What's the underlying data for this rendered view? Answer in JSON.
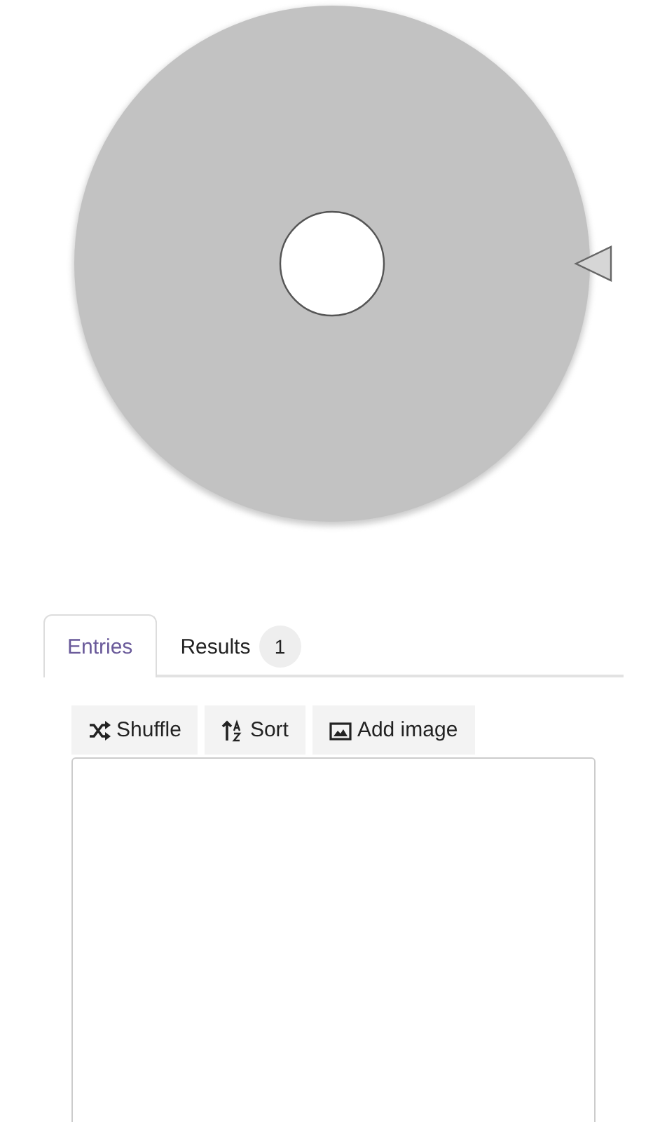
{
  "tabs": [
    {
      "label": "Entries",
      "selected": true
    },
    {
      "label": "Results",
      "selected": false,
      "badge": "1"
    }
  ],
  "toolbar": [
    {
      "kind": "shuffle",
      "label": "Shuffle"
    },
    {
      "kind": "sort",
      "label": "Sort"
    },
    {
      "kind": "image",
      "label": "Add image"
    }
  ]
}
